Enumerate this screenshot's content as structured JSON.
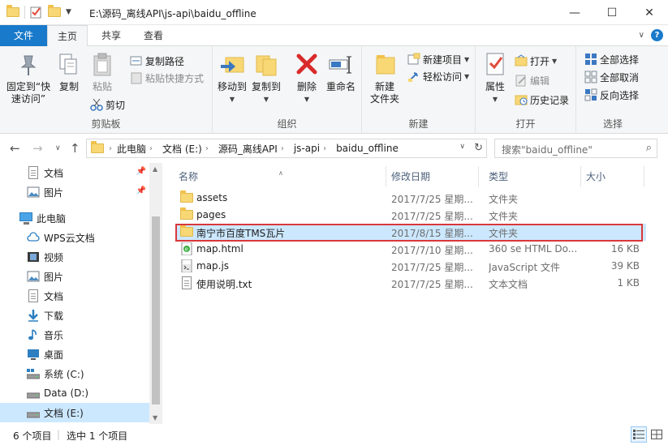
{
  "window": {
    "title": "E:\\源码_离线API\\js-api\\baidu_offline",
    "minimize": "—",
    "maximize": "☐",
    "close": "✕"
  },
  "tabs": {
    "file": "文件",
    "home": "主页",
    "share": "共享",
    "view": "查看"
  },
  "ribbon": {
    "clipboard": {
      "label": "剪贴板",
      "pin": "固定到“快速访问”",
      "copy": "复制",
      "paste": "粘贴",
      "copy_path": "复制路径",
      "paste_shortcut": "粘贴快捷方式",
      "cut": "剪切"
    },
    "organize": {
      "label": "组织",
      "move_to": "移动到",
      "copy_to": "复制到",
      "delete": "删除",
      "rename": "重命名"
    },
    "new": {
      "label": "新建",
      "new_folder": "新建\n文件夹",
      "new_item": "新建项目",
      "easy_access": "轻松访问"
    },
    "open": {
      "label": "打开",
      "properties": "属性",
      "open": "打开",
      "edit": "编辑",
      "history": "历史记录"
    },
    "select": {
      "label": "选择",
      "select_all": "全部选择",
      "select_none": "全部取消",
      "invert": "反向选择"
    }
  },
  "address": {
    "crumbs": [
      "此电脑",
      "文档 (E:)",
      "源码_离线API",
      "js-api",
      "baidu_offline"
    ],
    "search_placeholder": "搜索\"baidu_offline\""
  },
  "nav": {
    "items": [
      {
        "label": "文档",
        "icon": "documents-icon",
        "pinned": true
      },
      {
        "label": "图片",
        "icon": "pictures-icon",
        "pinned": true
      },
      {
        "label": "此电脑",
        "icon": "this-pc-icon",
        "pinned": false
      },
      {
        "label": "WPS云文档",
        "icon": "cloud-icon",
        "pinned": false
      },
      {
        "label": "视频",
        "icon": "videos-icon",
        "pinned": false
      },
      {
        "label": "图片",
        "icon": "pictures-icon",
        "pinned": false
      },
      {
        "label": "文档",
        "icon": "documents-icon",
        "pinned": false
      },
      {
        "label": "下载",
        "icon": "downloads-icon",
        "pinned": false
      },
      {
        "label": "音乐",
        "icon": "music-icon",
        "pinned": false
      },
      {
        "label": "桌面",
        "icon": "desktop-icon",
        "pinned": false
      },
      {
        "label": "系统 (C:)",
        "icon": "drive-icon",
        "pinned": false
      },
      {
        "label": "Data (D:)",
        "icon": "drive-icon",
        "pinned": false
      },
      {
        "label": "文档 (E:)",
        "icon": "drive-icon",
        "pinned": false
      }
    ]
  },
  "columns": {
    "name": "名称",
    "date": "修改日期",
    "type": "类型",
    "size": "大小"
  },
  "files": [
    {
      "name": "assets",
      "date": "2017/7/25 星期...",
      "type": "文件夹",
      "size": "",
      "icon": "folder-icon"
    },
    {
      "name": "pages",
      "date": "2017/7/25 星期...",
      "type": "文件夹",
      "size": "",
      "icon": "folder-icon"
    },
    {
      "name": "南宁市百度TMS瓦片",
      "date": "2017/8/15 星期...",
      "type": "文件夹",
      "size": "",
      "icon": "folder-icon"
    },
    {
      "name": "map.html",
      "date": "2017/7/10 星期...",
      "type": "360 se HTML Do...",
      "size": "16 KB",
      "icon": "html-file-icon"
    },
    {
      "name": "map.js",
      "date": "2017/7/25 星期...",
      "type": "JavaScript 文件",
      "size": "39 KB",
      "icon": "js-file-icon"
    },
    {
      "name": "使用说明.txt",
      "date": "2017/7/25 星期...",
      "type": "文本文档",
      "size": "1 KB",
      "icon": "text-file-icon"
    }
  ],
  "status": {
    "count": "6 个项目",
    "selected": "选中 1 个项目"
  },
  "colors": {
    "accent": "#1979ca",
    "selection": "#cce8ff",
    "highlight_border": "#d9373c"
  }
}
